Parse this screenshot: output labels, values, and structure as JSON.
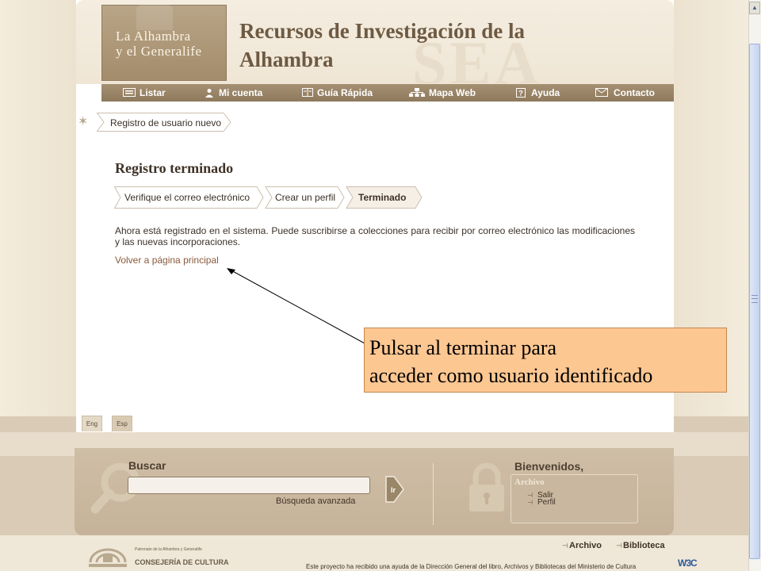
{
  "site": {
    "logo_line1": "La Alhambra",
    "logo_line2": "y el Generalife",
    "title_line1": "Recursos de Investigación de la",
    "title_line2": "Alhambra"
  },
  "nav": {
    "items": [
      {
        "label": "Listar",
        "icon": "list-icon"
      },
      {
        "label": "Mi cuenta",
        "icon": "user-icon"
      },
      {
        "label": "Guía Rápida",
        "icon": "book-icon"
      },
      {
        "label": "Mapa Web",
        "icon": "sitemap-icon"
      },
      {
        "label": "Ayuda",
        "icon": "help-icon"
      },
      {
        "label": "Contacto",
        "icon": "envelope-icon"
      }
    ]
  },
  "breadcrumb": {
    "current": "Registro de usuario nuevo"
  },
  "content": {
    "title": "Registro terminado",
    "steps": [
      "Verifique el correo electrónico",
      "Crear un perfil",
      "Terminado"
    ],
    "message": "Ahora está registrado en el sistema. Puede suscribirse a colecciones para recibir por correo electrónico las modificaciones y las nuevas incorporaciones.",
    "home_link": "Volver a página principal"
  },
  "annotation": {
    "line1": "Pulsar al terminar para",
    "line2": "acceder como usuario  identificado"
  },
  "language": {
    "eng": "Eng",
    "esp": "Esp"
  },
  "search": {
    "title": "Buscar",
    "value": "",
    "go_label": "Ir",
    "advanced": "Búsqueda avanzada"
  },
  "user_panel": {
    "welcome": "Bienvenidos,",
    "box_title": "Archivo",
    "links": [
      "Salir",
      "Perfil"
    ]
  },
  "footer": {
    "patronato": "Patronato de la Alhambra y Generalife",
    "consejeria": "CONSEJERÍA DE CULTURA",
    "links": [
      "Archivo",
      "Biblioteca"
    ],
    "funding_note": "Este proyecto ha recibido una ayuda de la Dirección General del libro, Archivos y Bibliotecas del Ministerio de Cultura",
    "w3c": "W3C"
  },
  "colors": {
    "brand_brown": "#6e5a42",
    "nav_bar": "#8e7a5d",
    "annotation_fill": "#fdc792",
    "link": "#8a5a3b"
  }
}
